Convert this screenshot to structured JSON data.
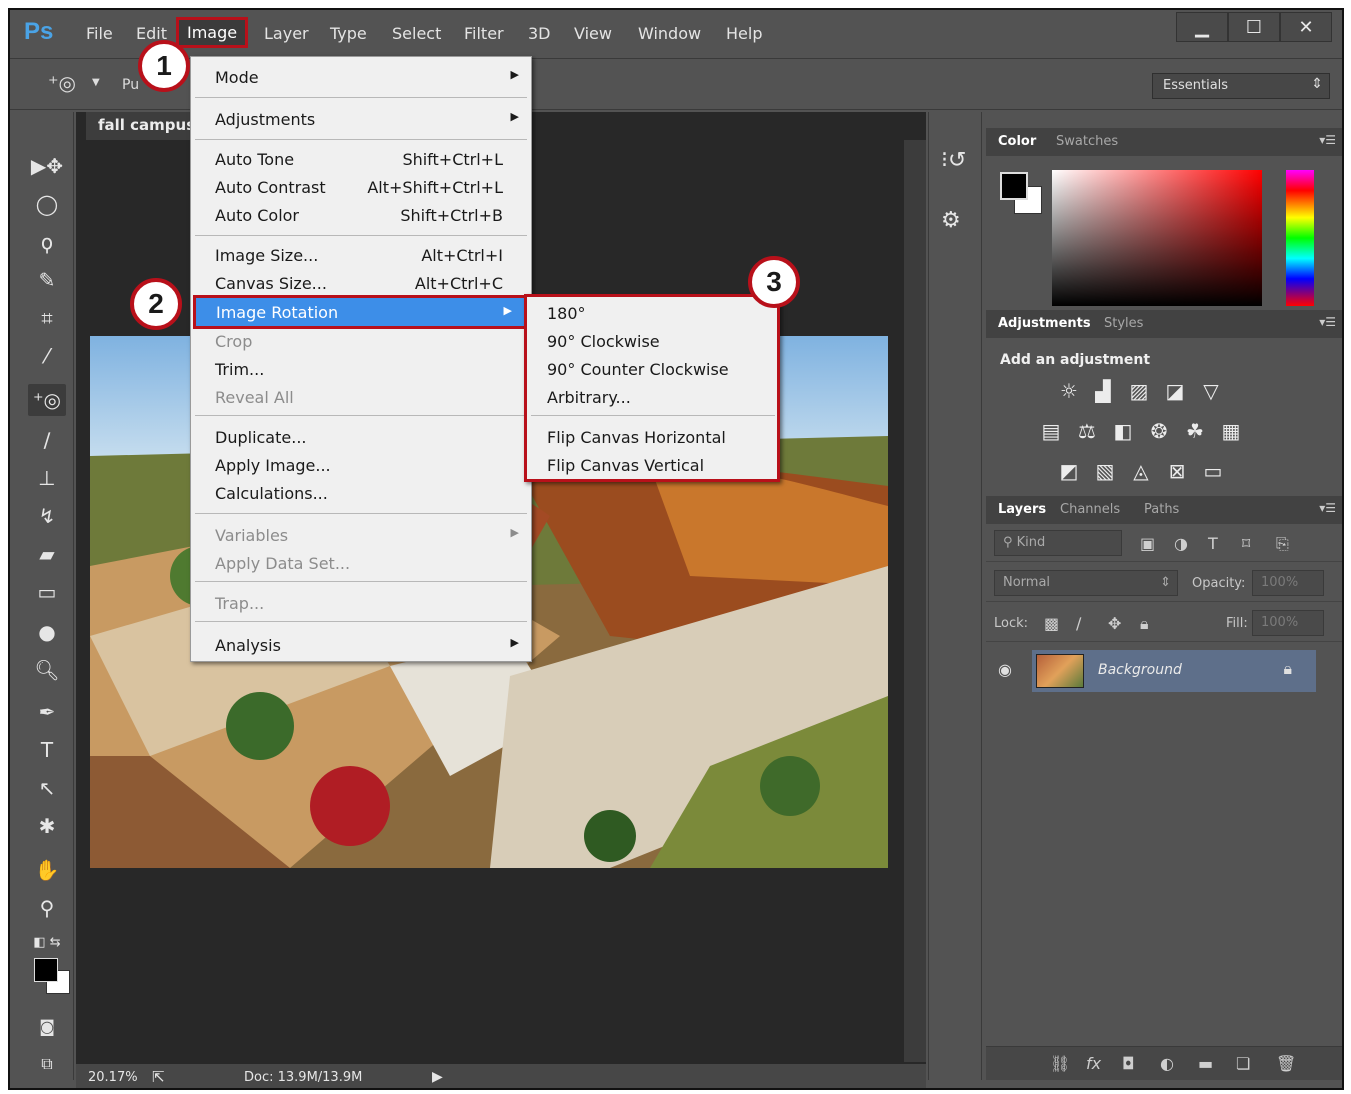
{
  "app": {
    "logo": "Ps",
    "menus": [
      "File",
      "Edit",
      "Image",
      "Layer",
      "Type",
      "Select",
      "Filter",
      "3D",
      "View",
      "Window",
      "Help"
    ],
    "window_controls": [
      "minimize",
      "maximize",
      "close"
    ]
  },
  "options_bar": {
    "tool_label": "Pu",
    "workspace": "Essentials"
  },
  "document": {
    "tab_title": "fall campus",
    "zoom": "20.17%",
    "doc_info": "Doc: 13.9M/13.9M"
  },
  "image_menu": {
    "items": [
      {
        "label": "Mode",
        "shortcut": "",
        "submenu": true,
        "disabled": false
      },
      {
        "label": "Adjustments",
        "shortcut": "",
        "submenu": true,
        "disabled": false
      },
      {
        "label": "Auto Tone",
        "shortcut": "Shift+Ctrl+L",
        "submenu": false,
        "disabled": false
      },
      {
        "label": "Auto Contrast",
        "shortcut": "Alt+Shift+Ctrl+L",
        "submenu": false,
        "disabled": false
      },
      {
        "label": "Auto Color",
        "shortcut": "Shift+Ctrl+B",
        "submenu": false,
        "disabled": false
      },
      {
        "label": "Image Size...",
        "shortcut": "Alt+Ctrl+I",
        "submenu": false,
        "disabled": false
      },
      {
        "label": "Canvas Size...",
        "shortcut": "Alt+Ctrl+C",
        "submenu": false,
        "disabled": false
      },
      {
        "label": "Image Rotation",
        "shortcut": "",
        "submenu": true,
        "disabled": false,
        "highlighted": true
      },
      {
        "label": "Crop",
        "shortcut": "",
        "submenu": false,
        "disabled": true
      },
      {
        "label": "Trim...",
        "shortcut": "",
        "submenu": false,
        "disabled": false
      },
      {
        "label": "Reveal All",
        "shortcut": "",
        "submenu": false,
        "disabled": true
      },
      {
        "label": "Duplicate...",
        "shortcut": "",
        "submenu": false,
        "disabled": false
      },
      {
        "label": "Apply Image...",
        "shortcut": "",
        "submenu": false,
        "disabled": false
      },
      {
        "label": "Calculations...",
        "shortcut": "",
        "submenu": false,
        "disabled": false
      },
      {
        "label": "Variables",
        "shortcut": "",
        "submenu": true,
        "disabled": true
      },
      {
        "label": "Apply Data Set...",
        "shortcut": "",
        "submenu": false,
        "disabled": true
      },
      {
        "label": "Trap...",
        "shortcut": "",
        "submenu": false,
        "disabled": true
      },
      {
        "label": "Analysis",
        "shortcut": "",
        "submenu": true,
        "disabled": false
      }
    ]
  },
  "rotation_submenu": {
    "items": [
      "180°",
      "90° Clockwise",
      "90° Counter Clockwise",
      "Arbitrary...",
      "Flip Canvas Horizontal",
      "Flip Canvas Vertical"
    ]
  },
  "callouts": [
    "1",
    "2",
    "3"
  ],
  "color_panel": {
    "tabs": [
      "Color",
      "Swatches"
    ],
    "foreground": "#000000",
    "background": "#ffffff"
  },
  "adjustments_panel": {
    "tabs": [
      "Adjustments",
      "Styles"
    ],
    "title": "Add an adjustment"
  },
  "layers_panel": {
    "tabs": [
      "Layers",
      "Channels",
      "Paths"
    ],
    "filter_label": "Kind",
    "blend_mode": "Normal",
    "opacity_label": "Opacity:",
    "opacity_value": "100%",
    "lock_label": "Lock:",
    "fill_label": "Fill:",
    "fill_value": "100%",
    "layer_name": "Background"
  },
  "colors": {
    "accent_highlight": "#3d8ee8",
    "callout_red": "#b8101a",
    "ui_gray": "#535353"
  }
}
